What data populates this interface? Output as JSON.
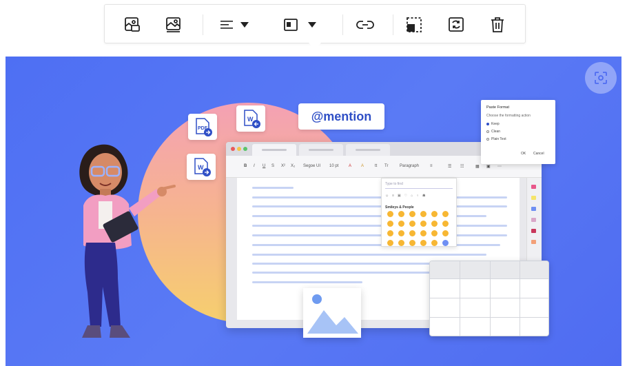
{
  "toolbar": {
    "buttons": [
      {
        "name": "image-alt-text-button",
        "icon": "image-caption-icon"
      },
      {
        "name": "image-edit-button",
        "icon": "image-icon"
      },
      {
        "name": "align-dropdown-button",
        "icon": "align-left-icon"
      },
      {
        "name": "display-dropdown-button",
        "icon": "inline-display-icon"
      },
      {
        "name": "insert-link-button",
        "icon": "link-icon"
      },
      {
        "name": "image-dimension-button",
        "icon": "resize-icon"
      },
      {
        "name": "replace-image-button",
        "icon": "replace-image-icon"
      },
      {
        "name": "delete-image-button",
        "icon": "trash-icon"
      }
    ]
  },
  "illustration": {
    "mention_label": "@mention",
    "file_badges": [
      "PDF",
      "W",
      "W"
    ],
    "editor_toolbar": {
      "font": "Segoe UI",
      "size": "10 pt",
      "format": "Paragraph"
    },
    "emoji_panel": {
      "search_placeholder": "Type to find",
      "category": "Smileys & People"
    },
    "paste_dialog": {
      "title": "Paste Format",
      "subtitle": "Choose the formatting action",
      "options": [
        "Keep",
        "Clean",
        "Plain Text"
      ],
      "ok_label": "OK",
      "cancel_label": "Cancel"
    }
  },
  "colors": {
    "stage_blue": "#4f6cf1",
    "accent_blue": "#2f4fc6",
    "swatches": [
      "#e8578a",
      "#f5e46a",
      "#6f8ff3",
      "#d9a6c8",
      "#c8375b",
      "#f3a078"
    ]
  }
}
